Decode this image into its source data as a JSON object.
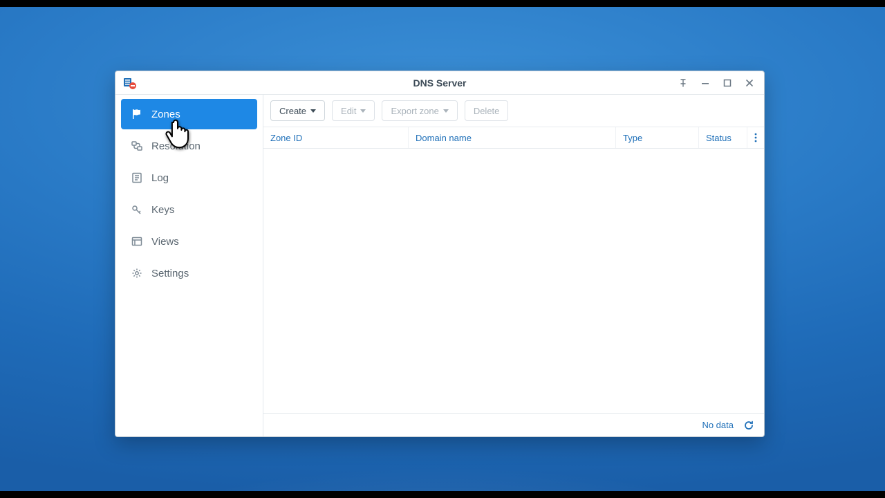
{
  "window": {
    "title": "DNS Server"
  },
  "sidebar": {
    "items": [
      {
        "label": "Zones"
      },
      {
        "label": "Resolution"
      },
      {
        "label": "Log"
      },
      {
        "label": "Keys"
      },
      {
        "label": "Views"
      },
      {
        "label": "Settings"
      }
    ]
  },
  "toolbar": {
    "create": "Create",
    "edit": "Edit",
    "export": "Export zone",
    "delete": "Delete"
  },
  "columns": {
    "zone_id": "Zone ID",
    "domain_name": "Domain name",
    "type": "Type",
    "status": "Status"
  },
  "status": {
    "no_data": "No data"
  }
}
